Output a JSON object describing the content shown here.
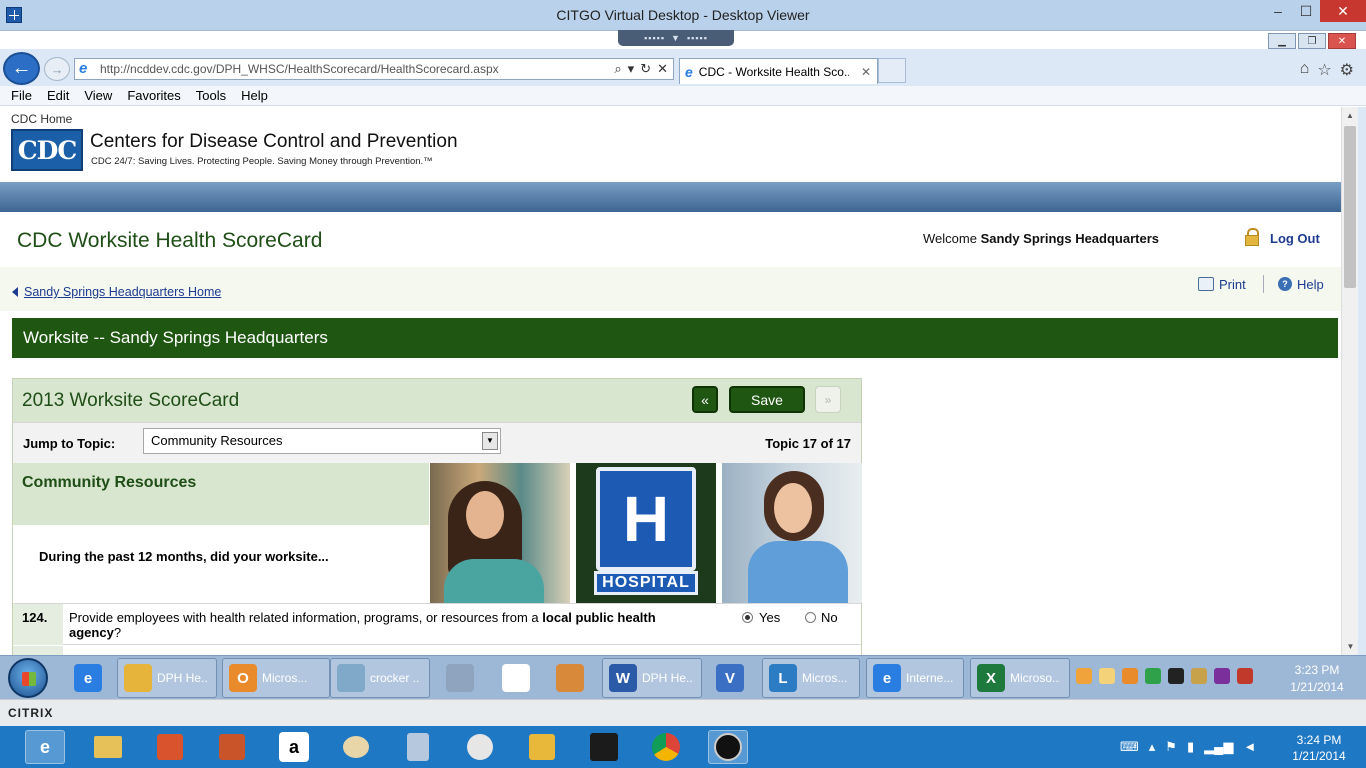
{
  "viewer": {
    "title": "CITGO Virtual Desktop - Desktop Viewer",
    "minimize": "–",
    "maximize": "☐",
    "close": "✕"
  },
  "browser": {
    "url": "http://ncddev.cdc.gov/DPH_WHSC/HealthScorecard/HealthScorecard.aspx",
    "tab_title": "CDC - Worksite Health Sco...",
    "tab_close": "✕",
    "menu": [
      "File",
      "Edit",
      "View",
      "Favorites",
      "Tools",
      "Help"
    ]
  },
  "cdc": {
    "home_link": "CDC Home",
    "logo_text": "CDC",
    "name": "Centers for Disease Control and Prevention",
    "tagline": "CDC 24/7: Saving Lives. Protecting People. Saving Money through Prevention.™"
  },
  "app": {
    "title": "CDC Worksite Health ScoreCard",
    "welcome_prefix": "Welcome ",
    "welcome_user": "Sandy Springs Headquarters",
    "logout": "Log Out",
    "breadcrumb": "Sandy Springs Headquarters Home",
    "print": "Print",
    "help": "Help",
    "worksite_banner": "Worksite -- Sandy Springs Headquarters"
  },
  "scorecard": {
    "title": "2013 Worksite ScoreCard",
    "prev_label": "«",
    "save_label": "Save",
    "next_label": "»",
    "jump_label": "Jump to Topic:",
    "jump_selected": "Community Resources",
    "topic_count": "Topic 17 of 17",
    "topic_heading": "Community Resources",
    "question_intro": "During the past 12 months, did your worksite...",
    "questions": [
      {
        "number": "124.",
        "text_before": "Provide employees with health related information, programs, or resources from a ",
        "text_bold": "local public health agency",
        "text_after": "?",
        "yes": "Yes",
        "no": "No",
        "answer": "Yes"
      }
    ]
  },
  "remote_taskbar": {
    "items": [
      {
        "label": "DPH He...",
        "color": "#e6b43a"
      },
      {
        "label": "Micros...",
        "color": "#e98b2a"
      },
      {
        "label": "crocker ...",
        "color": "#7fa8c9"
      },
      {
        "label": "DPH He...",
        "color": "#2b5aa8"
      },
      {
        "label": "Micros...",
        "color": "#2c7cc4"
      },
      {
        "label": "Interne...",
        "color": "#2a7de1"
      },
      {
        "label": "Microso...",
        "color": "#1e7a3c"
      }
    ],
    "time": "3:23 PM",
    "date": "1/21/2014"
  },
  "citrix": {
    "logo": "CITRIX"
  },
  "local_taskbar": {
    "time": "3:24 PM",
    "date": "1/21/2014"
  }
}
